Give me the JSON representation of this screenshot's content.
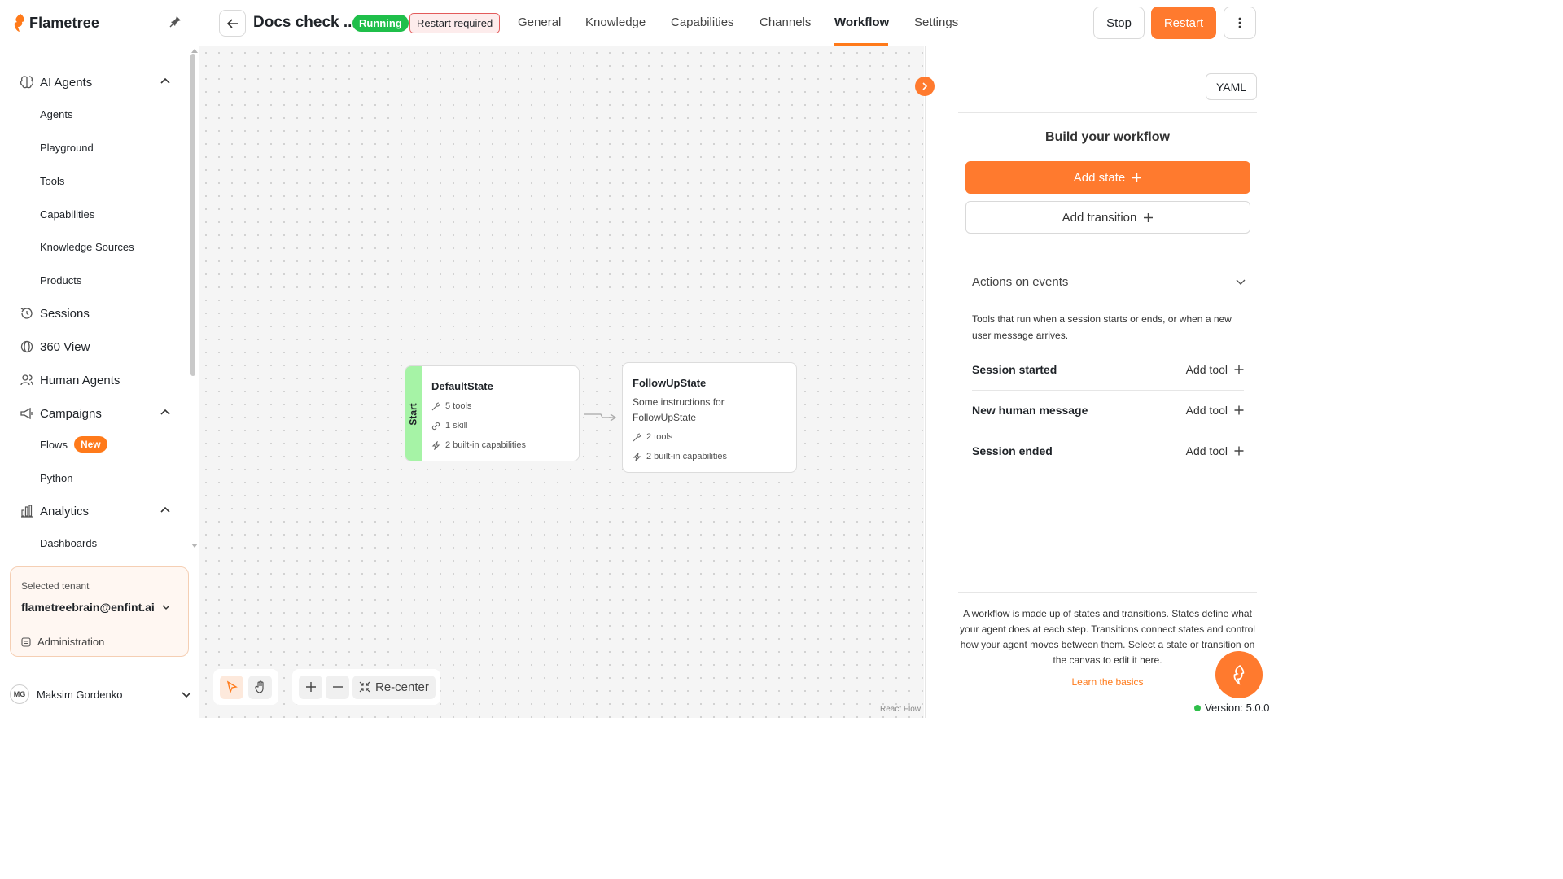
{
  "brand": {
    "name": "Flametree",
    "accent": "#ff7a1a"
  },
  "sidebar": {
    "groups": [
      {
        "label": "AI Agents",
        "icon": "brain-icon",
        "expanded": true,
        "items": [
          "Agents",
          "Playground",
          "Tools",
          "Capabilities",
          "Knowledge Sources",
          "Products"
        ]
      },
      {
        "label": "Sessions",
        "icon": "history-icon"
      },
      {
        "label": "360 View",
        "icon": "view-360-icon"
      },
      {
        "label": "Human Agents",
        "icon": "users-icon"
      },
      {
        "label": "Campaigns",
        "icon": "megaphone-icon",
        "expanded": true,
        "items": [
          "Flows",
          "Python"
        ],
        "flows_badge": "New"
      },
      {
        "label": "Analytics",
        "icon": "bar-chart-icon",
        "expanded": true,
        "items": [
          "Dashboards"
        ]
      }
    ],
    "tenant": {
      "label": "Selected tenant",
      "value": "flametreebrain@enfint.ai",
      "admin": "Administration"
    },
    "user": {
      "initials": "MG",
      "name": "Maksim Gordenko"
    }
  },
  "header": {
    "title": "Docs check ...",
    "status": "Running",
    "status_color": "#1fbf4a",
    "warning": "Restart required",
    "tabs": [
      "General",
      "Knowledge",
      "Capabilities",
      "Channels",
      "Workflow",
      "Settings"
    ],
    "active_tab": "Workflow",
    "stop_label": "Stop",
    "restart_label": "Restart"
  },
  "canvas": {
    "nodes": [
      {
        "title": "DefaultState",
        "start_label": "Start",
        "lines": [
          "5 tools",
          "1 skill",
          "2 built-in capabilities"
        ]
      },
      {
        "title": "FollowUpState",
        "description": "Some instructions for FollowUpState",
        "lines": [
          "2 tools",
          "2 built-in capabilities"
        ]
      }
    ],
    "recenter_label": "Re-center",
    "attribution": "React Flow"
  },
  "panel": {
    "yaml_label": "YAML",
    "title": "Build your workflow",
    "add_state": "Add state",
    "add_transition": "Add transition",
    "actions_title": "Actions on events",
    "actions_desc": "Tools that run when a session starts or ends, or when a new user message arrives.",
    "events": [
      "Session started",
      "New human message",
      "Session ended"
    ],
    "add_tool_label": "Add tool",
    "help": "A workflow is made up of states and transitions. States define what your agent does at each step. Transitions connect states and control how your agent moves between them. Select a state or transition on the canvas to edit it here.",
    "learn": "Learn the basics"
  },
  "footer": {
    "version": "Version: 5.0.0"
  }
}
